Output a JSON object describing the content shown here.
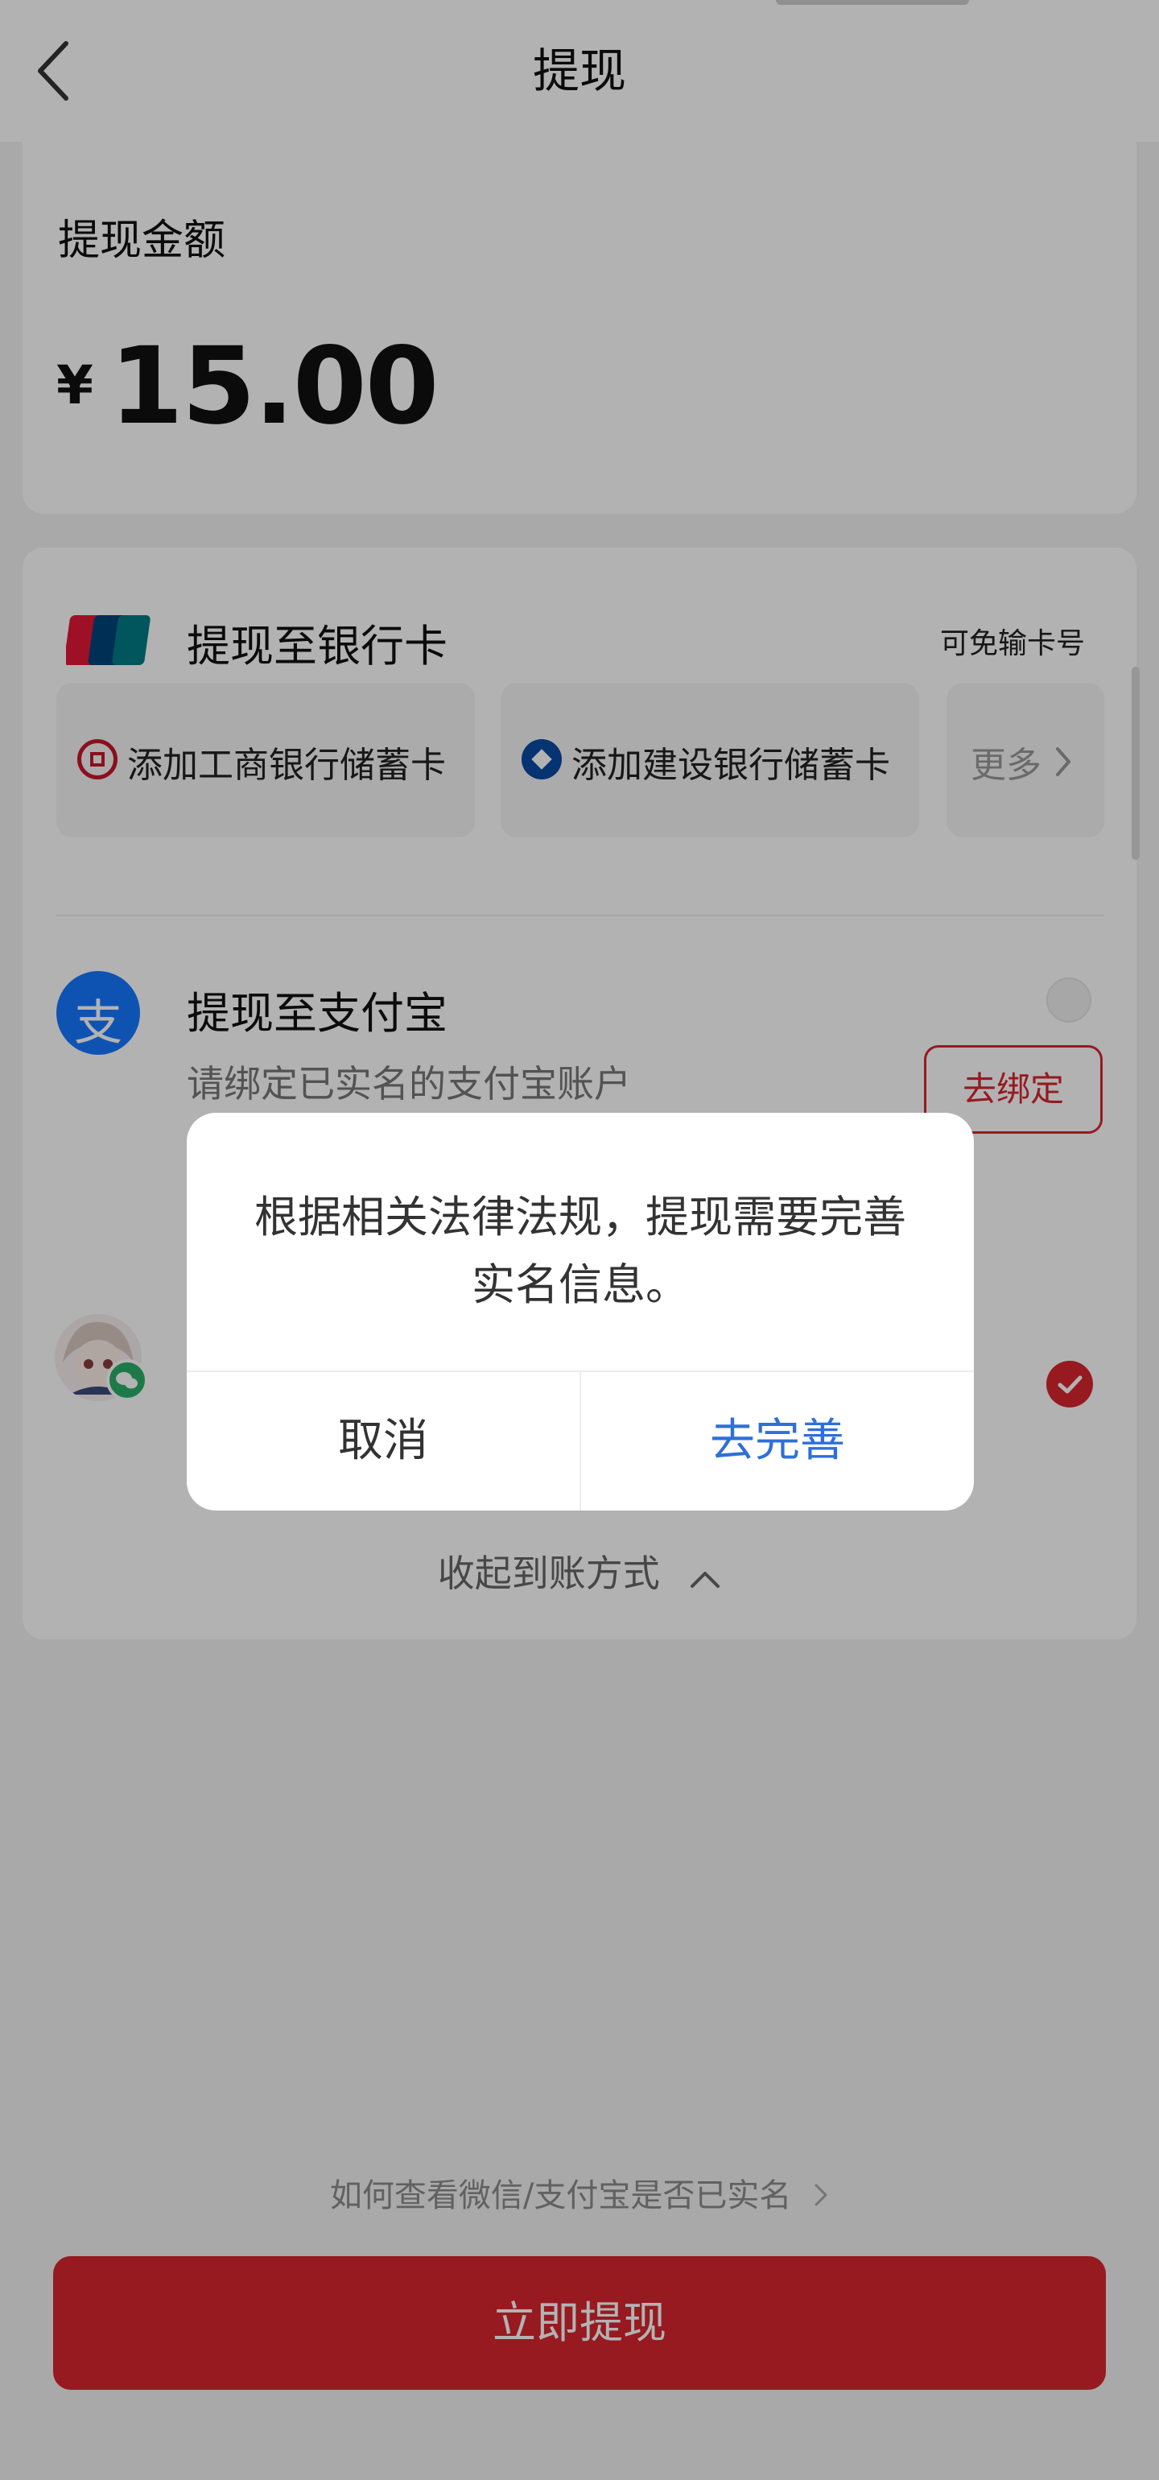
{
  "header": {
    "title": "提现",
    "back_icon": "chevron-left-icon"
  },
  "amount": {
    "label": "提现金额",
    "currency": "¥",
    "value": "15.00"
  },
  "bank": {
    "title": "提现至银行卡",
    "no_card_hint": "可免输卡号",
    "chips": [
      {
        "label": "添加工商银行储蓄卡",
        "icon": "icbc-logo-icon"
      },
      {
        "label": "添加建设银行储蓄卡",
        "icon": "ccb-logo-icon"
      }
    ],
    "more_label": "更多"
  },
  "alipay": {
    "title": "提现至支付宝",
    "subtitle": "请绑定已实名的支付宝账户",
    "bind_label": "去绑定",
    "logo_glyph": "支"
  },
  "wechat": {
    "selected": true
  },
  "collapse_label": "收起到账方式",
  "help_link": "如何查看微信/支付宝是否已实名",
  "submit_label": "立即提现",
  "dialog": {
    "message": "根据相关法律法规，提现需要完善实名信息。",
    "cancel": "取消",
    "confirm": "去完善"
  },
  "colors": {
    "accent_red": "#d7262e",
    "link_blue": "#2f6fd8",
    "alipay_blue": "#1677ff",
    "wechat_green": "#2aae67"
  }
}
